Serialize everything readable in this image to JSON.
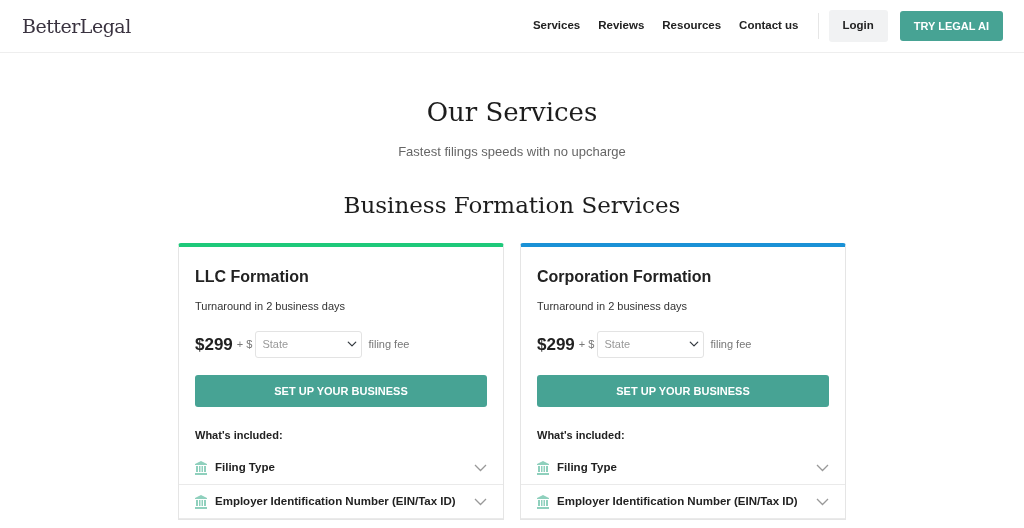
{
  "brand": "BetterLegal",
  "nav": {
    "links": [
      "Services",
      "Reviews",
      "Resources",
      "Contact us"
    ],
    "login": "Login",
    "cta": "TRY LEGAL AI"
  },
  "hero": {
    "title": "Our Services",
    "subtitle": "Fastest filings speeds with no upcharge"
  },
  "section": {
    "title": "Business Formation Services"
  },
  "cards": [
    {
      "title": "LLC Formation",
      "color": "#1ec97a",
      "turnaround": "Turnaround in 2 business days",
      "price": "$299",
      "plus": "+ $",
      "state": {
        "placeholder": "State"
      },
      "fee": "filing fee",
      "button": "SET UP YOUR BUSINESS",
      "included": "What's included:",
      "items": [
        {
          "label": "Filing Type",
          "expanded": false
        },
        {
          "label": "Employer Identification Number (EIN/Tax ID)",
          "expanded": false
        }
      ]
    },
    {
      "title": "Corporation Formation",
      "color": "#1a91d6",
      "turnaround": "Turnaround in 2 business days",
      "price": "$299",
      "plus": "+ $",
      "state": {
        "placeholder": "State"
      },
      "fee": "filing fee",
      "button": "SET UP YOUR BUSINESS",
      "included": "What's included:",
      "items": [
        {
          "label": "Filing Type",
          "expanded": false
        },
        {
          "label": "Employer Identification Number (EIN/Tax ID)",
          "expanded": false
        }
      ]
    }
  ]
}
